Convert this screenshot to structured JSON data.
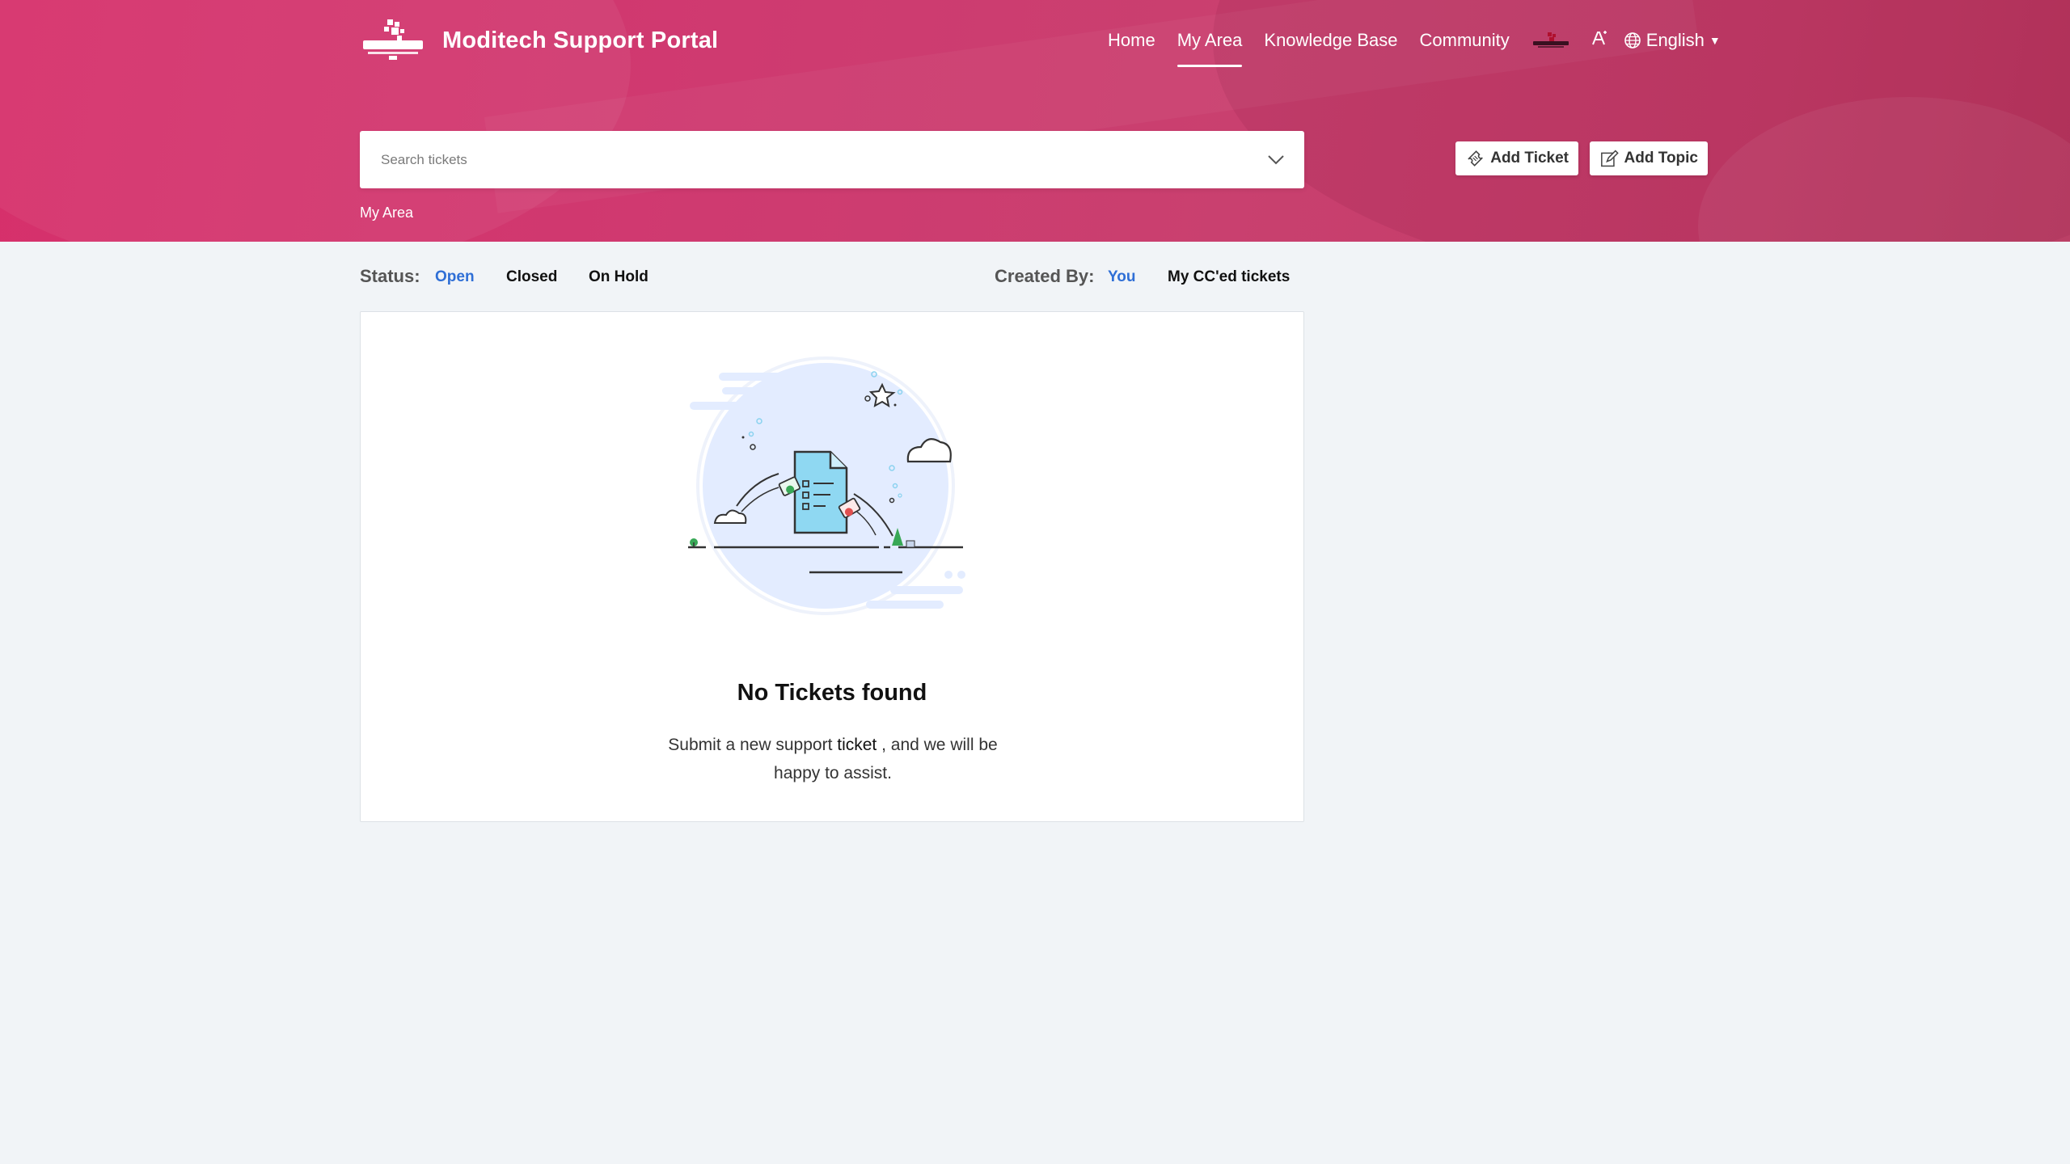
{
  "header": {
    "brand_title": "Moditech Support Portal",
    "nav": [
      {
        "label": "Home"
      },
      {
        "label": "My Area",
        "active": true
      },
      {
        "label": "Knowledge Base"
      },
      {
        "label": "Community"
      }
    ],
    "font_size_icon": "font-size-icon",
    "language": "English",
    "search": {
      "placeholder": "Search tickets"
    },
    "breadcrumb": "My Area",
    "buttons": {
      "add_ticket": "Add Ticket",
      "add_topic": "Add Topic"
    }
  },
  "filters": {
    "status_label": "Status:",
    "status_options": [
      "Open",
      "Closed",
      "On Hold"
    ],
    "status_selected": "Open",
    "created_label": "Created By:",
    "created_options": [
      "You",
      "My CC'ed tickets"
    ],
    "created_selected": "You"
  },
  "empty_state": {
    "title": "No Tickets found",
    "msg_before": "Submit a new support ",
    "msg_link": "ticket",
    "msg_after": " , and we will be happy to assist."
  },
  "colors": {
    "header_gradient_start": "#d6306b",
    "header_gradient_end": "#b8365e",
    "active_filter": "#2f6fd6",
    "page_background": "#f1f4f7"
  }
}
